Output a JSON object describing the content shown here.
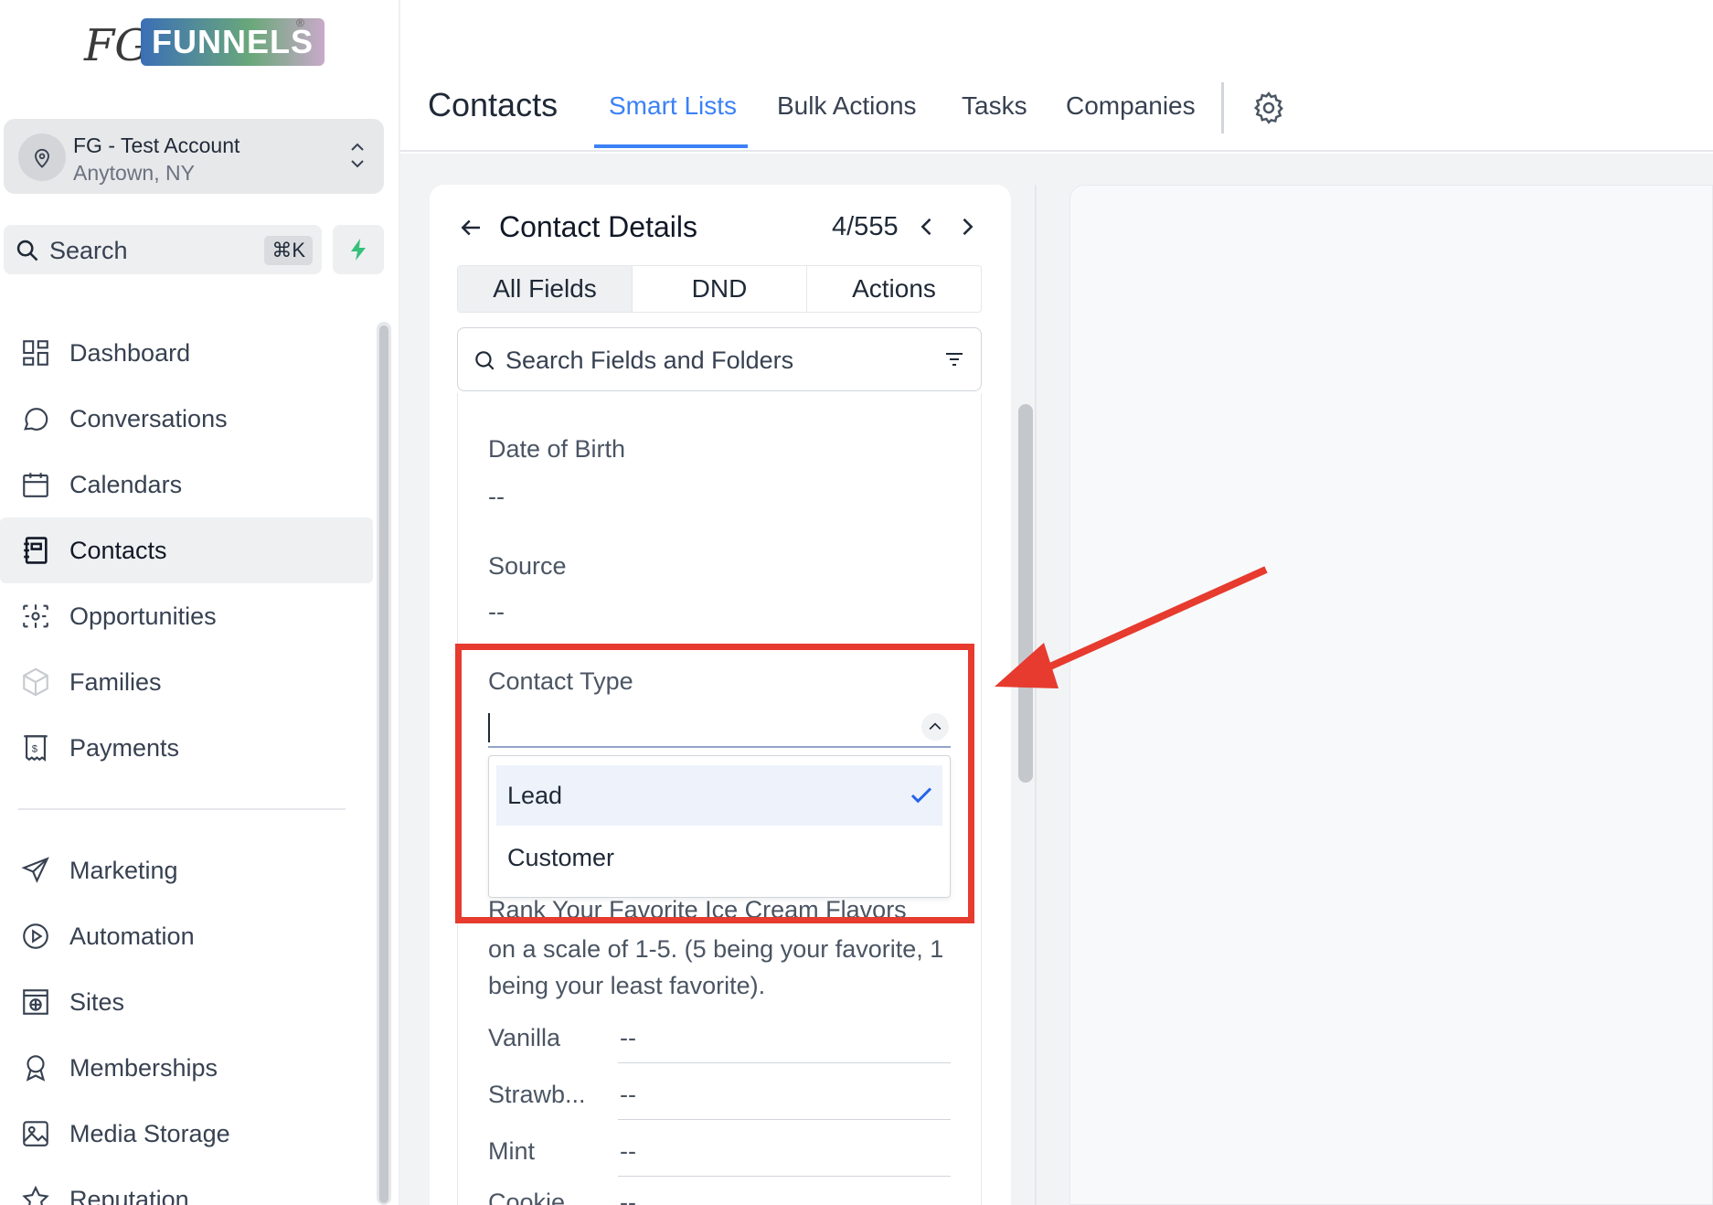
{
  "logo": {
    "prefix": "FG",
    "brand": "FUNNELS",
    "reg": "®"
  },
  "account": {
    "name": "FG - Test Account",
    "location": "Anytown, NY"
  },
  "search": {
    "label": "Search",
    "shortcut": "⌘K"
  },
  "nav": {
    "items": [
      {
        "label": "Dashboard",
        "icon": "dashboard-icon"
      },
      {
        "label": "Conversations",
        "icon": "chat-bubble-icon"
      },
      {
        "label": "Calendars",
        "icon": "calendar-icon"
      },
      {
        "label": "Contacts",
        "icon": "contacts-icon",
        "active": true
      },
      {
        "label": "Opportunities",
        "icon": "opportunities-icon"
      },
      {
        "label": "Families",
        "icon": "cube-icon"
      },
      {
        "label": "Payments",
        "icon": "receipt-icon"
      }
    ],
    "items2": [
      {
        "label": "Marketing",
        "icon": "send-icon"
      },
      {
        "label": "Automation",
        "icon": "play-circle-icon"
      },
      {
        "label": "Sites",
        "icon": "globe-window-icon"
      },
      {
        "label": "Memberships",
        "icon": "badge-icon"
      },
      {
        "label": "Media Storage",
        "icon": "image-icon"
      },
      {
        "label": "Reputation",
        "icon": "star-icon"
      }
    ]
  },
  "header": {
    "title": "Contacts",
    "tabs": [
      {
        "label": "Smart Lists",
        "active": true
      },
      {
        "label": "Bulk Actions"
      },
      {
        "label": "Tasks"
      },
      {
        "label": "Companies"
      }
    ]
  },
  "contact_details": {
    "title": "Contact Details",
    "count": "4/555",
    "segments": [
      "All Fields",
      "DND",
      "Actions"
    ],
    "search_placeholder": "Search Fields and Folders",
    "fields": [
      {
        "label": "Date of Birth",
        "value": "--"
      },
      {
        "label": "Source",
        "value": "--"
      }
    ],
    "contact_type": {
      "label": "Contact Type",
      "value": "",
      "options": [
        {
          "label": "Lead",
          "selected": true
        },
        {
          "label": "Customer",
          "selected": false
        }
      ]
    },
    "rank_question_top": "Rank Your Favorite Ice Cream Flavors",
    "rank_question_rest": "on a scale of 1-5. (5 being your favorite, 1 being your least favorite).",
    "rank_rows": [
      {
        "label": "Vanilla",
        "value": "--"
      },
      {
        "label": "Strawb...",
        "value": "--"
      },
      {
        "label": "Mint",
        "value": "--"
      },
      {
        "label": "Cookie",
        "value": "--"
      }
    ]
  },
  "colors": {
    "accent": "#3b82f6",
    "annotation": "#e63b2e"
  }
}
